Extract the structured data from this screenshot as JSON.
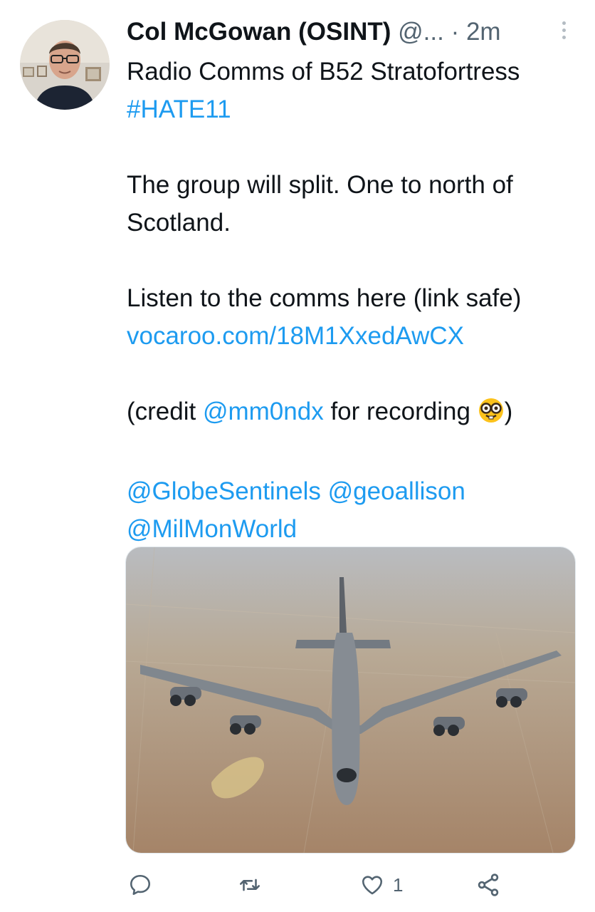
{
  "author": {
    "name": "Col McGowan (OSINT)",
    "handle": "@...",
    "separator": "·",
    "time": "2m"
  },
  "tweet": {
    "line1": "Radio Comms of B52 Stratofortress",
    "hashtag": "#HATE11",
    "para1_line1": "The group will split. One to north of",
    "para1_line2": "Scotland.",
    "para2_line1": "Listen to the comms here (link safe)",
    "para2_link": "vocaroo.com/18M1XxedAwCX",
    "credit_prefix": "(credit ",
    "credit_mention": "@mm0ndx",
    "credit_suffix": " for recording ",
    "credit_close": ")",
    "mention1": "@GlobeSentinels",
    "mention2": "@geoallison",
    "mention3": "@MilMonWorld"
  },
  "icons": {
    "reply": "reply-icon",
    "retweet": "retweet-icon",
    "like": "heart-icon",
    "share": "share-icon",
    "emoji": "nerd-face-emoji"
  },
  "actions": {
    "like_count": "1"
  },
  "colors": {
    "link": "#1d9bf0",
    "secondary_text": "#536471"
  }
}
